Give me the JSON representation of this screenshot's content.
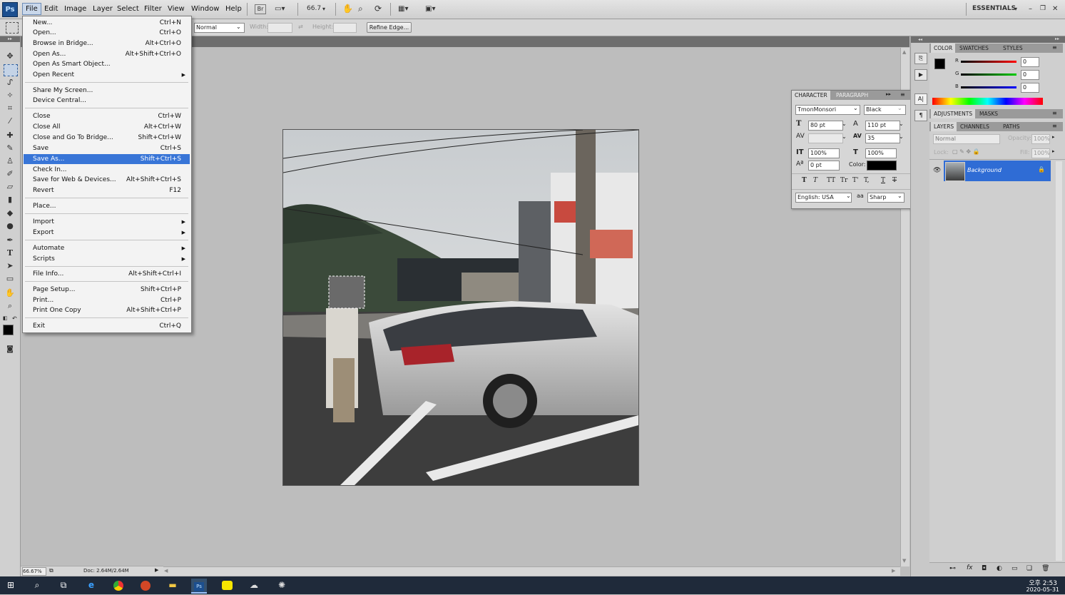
{
  "app": {
    "logo": "Ps",
    "workspace": "ESSENTIALS",
    "zoom_dropdown": "66.7"
  },
  "menubar": {
    "items": [
      "File",
      "Edit",
      "Image",
      "Layer",
      "Select",
      "Filter",
      "View",
      "Window",
      "Help"
    ]
  },
  "toolbar": {
    "bridge": "Br"
  },
  "options": {
    "style_value": "Normal",
    "width_label": "Width:",
    "height_label": "Height:",
    "refine_edge": "Refine Edge..."
  },
  "file_menu": {
    "items": [
      {
        "label": "New...",
        "shortcut": "Ctrl+N"
      },
      {
        "label": "Open...",
        "shortcut": "Ctrl+O"
      },
      {
        "label": "Browse in Bridge...",
        "shortcut": "Alt+Ctrl+O"
      },
      {
        "label": "Open As...",
        "shortcut": "Alt+Shift+Ctrl+O"
      },
      {
        "label": "Open As Smart Object...",
        "shortcut": ""
      },
      {
        "label": "Open Recent",
        "shortcut": ""
      },
      {
        "label": "Share My Screen...",
        "shortcut": ""
      },
      {
        "label": "Device Central...",
        "shortcut": ""
      },
      {
        "label": "Close",
        "shortcut": "Ctrl+W"
      },
      {
        "label": "Close All",
        "shortcut": "Alt+Ctrl+W"
      },
      {
        "label": "Close and Go To Bridge...",
        "shortcut": "Shift+Ctrl+W"
      },
      {
        "label": "Save",
        "shortcut": "Ctrl+S"
      },
      {
        "label": "Save As...",
        "shortcut": "Shift+Ctrl+S"
      },
      {
        "label": "Check In...",
        "shortcut": ""
      },
      {
        "label": "Save for Web & Devices...",
        "shortcut": "Alt+Shift+Ctrl+S"
      },
      {
        "label": "Revert",
        "shortcut": "F12"
      },
      {
        "label": "Place...",
        "shortcut": ""
      },
      {
        "label": "Import",
        "shortcut": ""
      },
      {
        "label": "Export",
        "shortcut": ""
      },
      {
        "label": "Automate",
        "shortcut": ""
      },
      {
        "label": "Scripts",
        "shortcut": ""
      },
      {
        "label": "File Info...",
        "shortcut": "Alt+Shift+Ctrl+I"
      },
      {
        "label": "Page Setup...",
        "shortcut": "Shift+Ctrl+P"
      },
      {
        "label": "Print...",
        "shortcut": "Ctrl+P"
      },
      {
        "label": "Print One Copy",
        "shortcut": "Alt+Shift+Ctrl+P"
      },
      {
        "label": "Exit",
        "shortcut": "Ctrl+Q"
      }
    ]
  },
  "color_panel": {
    "tabs": [
      "COLOR",
      "SWATCHES",
      "STYLES"
    ],
    "r_label": "R",
    "g_label": "G",
    "b_label": "B",
    "r": "0",
    "g": "0",
    "b": "0"
  },
  "adjustments_panel": {
    "tabs": [
      "ADJUSTMENTS",
      "MASKS"
    ]
  },
  "layers_panel": {
    "tabs": [
      "LAYERS",
      "CHANNELS",
      "PATHS"
    ],
    "blend_mode": "Normal",
    "opacity_label": "Opacity:",
    "opacity": "100%",
    "lock_label": "Lock:",
    "fill_label": "Fill:",
    "fill": "100%",
    "layer_name": "Background"
  },
  "character_panel": {
    "tabs": [
      "CHARACTER",
      "PARAGRAPH"
    ],
    "font_family": "TmonMonsori",
    "font_style": "Black",
    "font_size": "80 pt",
    "leading": "110 pt",
    "tracking": "35",
    "vertical_scale": "100%",
    "horizontal_scale": "100%",
    "baseline_shift": "0 pt",
    "color_label": "Color:",
    "language": "English: USA",
    "antialias_label": "aa",
    "antialias": "Sharp",
    "type_buttons": [
      "T",
      "T",
      "TT",
      "Tr",
      "T'",
      "T,",
      "T",
      "T"
    ]
  },
  "status": {
    "zoom": "66.67%",
    "doc": "Doc: 2.64M/2.64M"
  },
  "clock": {
    "time": "오후 2:53",
    "date": "2020-05-31"
  }
}
